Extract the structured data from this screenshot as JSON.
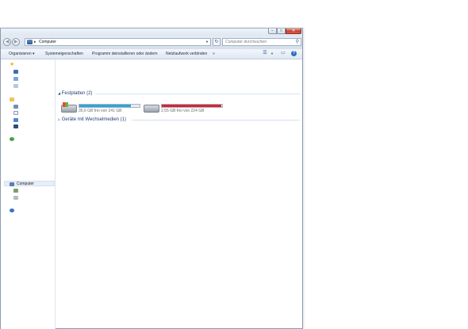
{
  "window": {
    "buttons": {
      "minimize": "–",
      "maximize": "□",
      "close": "✕"
    }
  },
  "address": {
    "location": "Computer",
    "separator": "▸",
    "search_placeholder": "Computer durchsuchen"
  },
  "toolbar": {
    "items": [
      "Organisieren ▾",
      "Systemeigenschaften",
      "Programm deinstallieren oder ändern",
      "Netzlaufwerk verbinden",
      "»"
    ],
    "help": "?"
  },
  "nav": {
    "computer_label": "Computer"
  },
  "groups": {
    "hard_disks": {
      "label": "Festplatten (2)",
      "arrow": "◢"
    },
    "removable": {
      "label": "Geräte mit Wechselmedien (1)",
      "arrow": "▷"
    }
  },
  "drives": [
    {
      "caption": "35,6 GB frei von 241 GB",
      "used_fraction": 0.85,
      "bar_color": "#2aa7dc",
      "has_windows_logo": true
    },
    {
      "caption": "2,55 GB frei von 224 GB",
      "used_fraction": 0.99,
      "bar_color": "#d8242f",
      "has_windows_logo": false
    }
  ],
  "colors": {
    "accent": "#2e5b93",
    "group_header": "#1e3f78"
  }
}
